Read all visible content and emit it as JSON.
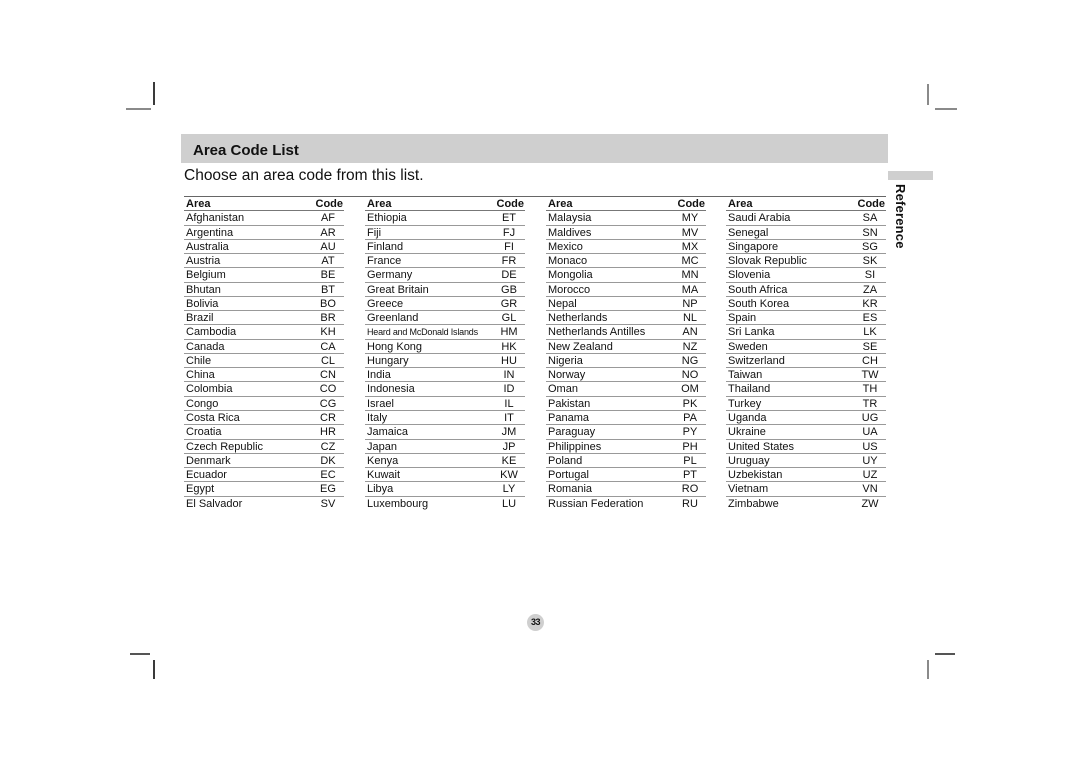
{
  "title": "Area Code List",
  "subtitle": "Choose an area code from this list.",
  "section_tab": "Reference",
  "page_number": "33",
  "header": {
    "area": "Area",
    "code": "Code"
  },
  "columns": [
    [
      {
        "area": "Afghanistan",
        "code": "AF"
      },
      {
        "area": "Argentina",
        "code": "AR"
      },
      {
        "area": "Australia",
        "code": "AU"
      },
      {
        "area": "Austria",
        "code": "AT"
      },
      {
        "area": "Belgium",
        "code": "BE"
      },
      {
        "area": "Bhutan",
        "code": "BT"
      },
      {
        "area": "Bolivia",
        "code": "BO"
      },
      {
        "area": "Brazil",
        "code": "BR"
      },
      {
        "area": "Cambodia",
        "code": "KH"
      },
      {
        "area": "Canada",
        "code": "CA"
      },
      {
        "area": "Chile",
        "code": "CL"
      },
      {
        "area": "China",
        "code": "CN"
      },
      {
        "area": "Colombia",
        "code": "CO"
      },
      {
        "area": "Congo",
        "code": "CG"
      },
      {
        "area": "Costa Rica",
        "code": "CR"
      },
      {
        "area": "Croatia",
        "code": "HR"
      },
      {
        "area": "Czech Republic",
        "code": "CZ"
      },
      {
        "area": "Denmark",
        "code": "DK"
      },
      {
        "area": "Ecuador",
        "code": "EC"
      },
      {
        "area": "Egypt",
        "code": "EG"
      },
      {
        "area": "El Salvador",
        "code": "SV"
      }
    ],
    [
      {
        "area": "Ethiopia",
        "code": "ET"
      },
      {
        "area": "Fiji",
        "code": "FJ"
      },
      {
        "area": "Finland",
        "code": "FI"
      },
      {
        "area": "France",
        "code": "FR"
      },
      {
        "area": "Germany",
        "code": "DE"
      },
      {
        "area": "Great Britain",
        "code": "GB"
      },
      {
        "area": "Greece",
        "code": "GR"
      },
      {
        "area": "Greenland",
        "code": "GL"
      },
      {
        "area": "Heard and McDonald Islands",
        "code": "HM"
      },
      {
        "area": "Hong Kong",
        "code": "HK"
      },
      {
        "area": "Hungary",
        "code": "HU"
      },
      {
        "area": "India",
        "code": "IN"
      },
      {
        "area": "Indonesia",
        "code": "ID"
      },
      {
        "area": "Israel",
        "code": "IL"
      },
      {
        "area": "Italy",
        "code": "IT"
      },
      {
        "area": "Jamaica",
        "code": "JM"
      },
      {
        "area": "Japan",
        "code": "JP"
      },
      {
        "area": "Kenya",
        "code": "KE"
      },
      {
        "area": "Kuwait",
        "code": "KW"
      },
      {
        "area": "Libya",
        "code": "LY"
      },
      {
        "area": "Luxembourg",
        "code": "LU"
      }
    ],
    [
      {
        "area": "Malaysia",
        "code": "MY"
      },
      {
        "area": "Maldives",
        "code": "MV"
      },
      {
        "area": "Mexico",
        "code": "MX"
      },
      {
        "area": "Monaco",
        "code": "MC"
      },
      {
        "area": "Mongolia",
        "code": "MN"
      },
      {
        "area": "Morocco",
        "code": "MA"
      },
      {
        "area": "Nepal",
        "code": "NP"
      },
      {
        "area": "Netherlands",
        "code": "NL"
      },
      {
        "area": "Netherlands Antilles",
        "code": "AN"
      },
      {
        "area": "New Zealand",
        "code": "NZ"
      },
      {
        "area": "Nigeria",
        "code": "NG"
      },
      {
        "area": "Norway",
        "code": "NO"
      },
      {
        "area": "Oman",
        "code": "OM"
      },
      {
        "area": "Pakistan",
        "code": "PK"
      },
      {
        "area": "Panama",
        "code": "PA"
      },
      {
        "area": "Paraguay",
        "code": "PY"
      },
      {
        "area": "Philippines",
        "code": "PH"
      },
      {
        "area": "Poland",
        "code": "PL"
      },
      {
        "area": "Portugal",
        "code": "PT"
      },
      {
        "area": "Romania",
        "code": "RO"
      },
      {
        "area": "Russian Federation",
        "code": "RU"
      }
    ],
    [
      {
        "area": "Saudi Arabia",
        "code": "SA"
      },
      {
        "area": "Senegal",
        "code": "SN"
      },
      {
        "area": "Singapore",
        "code": "SG"
      },
      {
        "area": "Slovak Republic",
        "code": "SK"
      },
      {
        "area": "Slovenia",
        "code": "SI"
      },
      {
        "area": "South Africa",
        "code": "ZA"
      },
      {
        "area": "South Korea",
        "code": "KR"
      },
      {
        "area": "Spain",
        "code": "ES"
      },
      {
        "area": "Sri Lanka",
        "code": "LK"
      },
      {
        "area": "Sweden",
        "code": "SE"
      },
      {
        "area": "Switzerland",
        "code": "CH"
      },
      {
        "area": "Taiwan",
        "code": "TW"
      },
      {
        "area": "Thailand",
        "code": "TH"
      },
      {
        "area": "Turkey",
        "code": "TR"
      },
      {
        "area": "Uganda",
        "code": "UG"
      },
      {
        "area": "Ukraine",
        "code": "UA"
      },
      {
        "area": "United States",
        "code": "US"
      },
      {
        "area": "Uruguay",
        "code": "UY"
      },
      {
        "area": "Uzbekistan",
        "code": "UZ"
      },
      {
        "area": "Vietnam",
        "code": "VN"
      },
      {
        "area": "Zimbabwe",
        "code": "ZW"
      }
    ]
  ]
}
